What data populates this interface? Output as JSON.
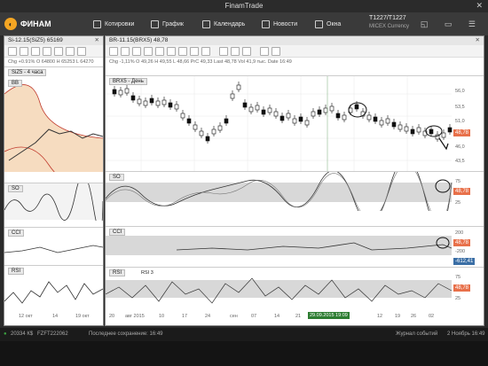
{
  "window": {
    "title": "FinamTrade"
  },
  "menu": {
    "logo": "ФИНАМ",
    "items": [
      "Котировки",
      "График",
      "Календарь",
      "Новости",
      "Окна"
    ],
    "account_id": "T1227/T1227",
    "account_sub": "MICEX Currency"
  },
  "left_panel": {
    "title": "Si-12.15(SiZ5) 65169",
    "info": "Chg +0.91%  O 64800  H 65253  L 64270",
    "main_label": "SiZ5 - 4 часа",
    "bb_label": "BB",
    "so_label": "SO",
    "cci_label": "CCI",
    "rsi_label": "RSI",
    "dates": [
      "12 окт",
      "15",
      "14",
      "19 окт"
    ]
  },
  "right_panel": {
    "title": "BR-11.15(BRX5) 48,78",
    "info": "Chg -1,11%  O 49,26  H 49,55  L 48,66  PrC 49,33  Last 48,78  Vol 41,9 тыс.  Date 16:49",
    "main_label": "BRX5 - День",
    "so_label": "SO",
    "cci_label": "CCI",
    "rsi_label": "RSI",
    "rsi_period": "RSI 3",
    "price_axis": [
      "56,0",
      "53,5",
      "51,0",
      "48,78",
      "46,0",
      "43,5"
    ],
    "last_price": "48,78",
    "so_axis": [
      "75",
      "48,78",
      "25"
    ],
    "cci_axis": [
      "200",
      "48,78",
      "-200",
      "-612,41"
    ],
    "rsi_axis": [
      "75",
      "48,78",
      "25"
    ],
    "dates": [
      "20",
      "авг 2015",
      "10",
      "17",
      "24",
      "сен",
      "07",
      "14",
      "21",
      "28",
      "05",
      "12",
      "19",
      "26",
      "02"
    ],
    "crosshair_date": "29.09.2015 19:09"
  },
  "status": {
    "balance": "20334 К$",
    "account": "FZFT222062",
    "saved": "Последнее сохранение: 16:49",
    "events": "Журнал событий",
    "time": "2 Ноябрь 16:49"
  },
  "colors": {
    "accent": "#f5a623",
    "price_tag": "#e8704a",
    "cci_tag": "#3a6ea5",
    "band": "#f6dcc0",
    "status_green": "#3aa040"
  }
}
